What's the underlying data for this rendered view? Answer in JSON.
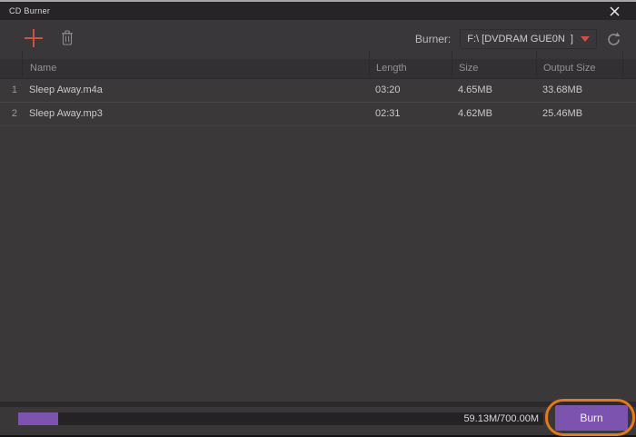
{
  "window": {
    "title": "CD Burner"
  },
  "toolbar": {
    "burner_label": "Burner:",
    "burner_value": "F:\\ [DVDRAM GUE0N  ]"
  },
  "icons": {
    "add": "plus-cross",
    "delete": "trash-can",
    "dropdown": "triangle-down",
    "refresh": "circular-arrow",
    "close": "close-x"
  },
  "table": {
    "columns": [
      "Name",
      "Length",
      "Size",
      "Output Size"
    ],
    "rows": [
      {
        "num": "1",
        "name": "Sleep Away.m4a",
        "length": "03:20",
        "size": "4.65MB",
        "output_size": "33.68MB"
      },
      {
        "num": "2",
        "name": "Sleep Away.mp3",
        "length": "02:31",
        "size": "4.62MB",
        "output_size": "25.46MB"
      }
    ]
  },
  "footer": {
    "progress_text": "59.13M/700.00M",
    "progress_fraction": 0.076,
    "burn_label": "Burn"
  },
  "colors": {
    "accent_purple": "#7c54af",
    "accent_red": "#cd5243",
    "annotation_orange": "#e2791c"
  }
}
